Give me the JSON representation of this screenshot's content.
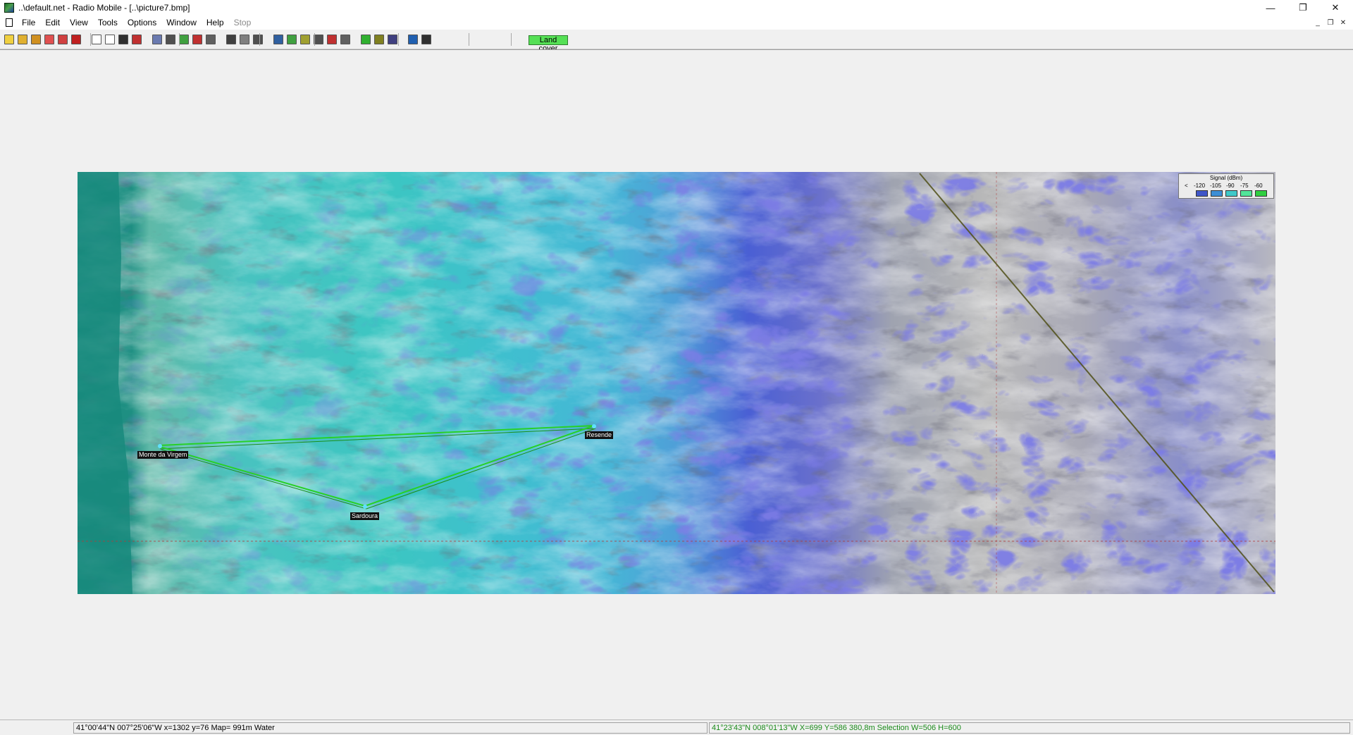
{
  "window": {
    "title": "..\\default.net - Radio Mobile - [..\\picture7.bmp]",
    "controls": {
      "minimize": "—",
      "restore": "❐",
      "close": "✕"
    },
    "mdi_controls": {
      "minimize": "_",
      "restore": "❐",
      "close": "✕"
    }
  },
  "menu": {
    "items": [
      "File",
      "Edit",
      "View",
      "Tools",
      "Options",
      "Window",
      "Help",
      "Stop"
    ]
  },
  "toolbar": {
    "land_cover_label": "Land cover",
    "buttons": [
      {
        "name": "new-icon",
        "color": "#f0d040"
      },
      {
        "name": "open-icon",
        "color": "#e0b030"
      },
      {
        "name": "open-networks-icon",
        "color": "#d09020"
      },
      {
        "name": "network-properties-icon",
        "color": "#e05050"
      },
      {
        "name": "unit-properties-icon",
        "color": "#d04040"
      },
      {
        "name": "radio-link-icon",
        "color": "#c02020"
      },
      {
        "name": "picture-new-icon",
        "color": "#ffffff"
      },
      {
        "name": "picture-open-icon",
        "color": "#ffffff"
      },
      {
        "name": "picture-save-icon",
        "color": "#303030"
      },
      {
        "name": "picture-close-icon",
        "color": "#c03030"
      },
      {
        "name": "copy-icon",
        "color": "#6a7ab0"
      },
      {
        "name": "merge-icon",
        "color": "#505050"
      },
      {
        "name": "terrain-icon",
        "color": "#40a040"
      },
      {
        "name": "rings-icon",
        "color": "#c03030"
      },
      {
        "name": "grayscale-icon",
        "color": "#606060"
      },
      {
        "name": "scale-icon",
        "color": "#404040"
      },
      {
        "name": "center-icon",
        "color": "#808080"
      },
      {
        "name": "map-properties-icon",
        "color": "#505050"
      },
      {
        "name": "map-window-icon",
        "color": "#3060a0"
      },
      {
        "name": "elevation-grid-icon",
        "color": "#40a040"
      },
      {
        "name": "polar-icon",
        "color": "#a0a030"
      },
      {
        "name": "cartesian-icon",
        "color": "#505050"
      },
      {
        "name": "find-best-site-icon",
        "color": "#c03030"
      },
      {
        "name": "coverage-icon",
        "color": "#606060"
      },
      {
        "name": "route-icon",
        "color": "#30b030"
      },
      {
        "name": "link-budget-icon",
        "color": "#808020"
      },
      {
        "name": "hop-icon",
        "color": "#404080"
      },
      {
        "name": "world-icon",
        "color": "#2060b0"
      },
      {
        "name": "globe-icon",
        "color": "#303030"
      }
    ]
  },
  "map": {
    "units": [
      "Monte da Virgem",
      "Resende",
      "Sardoura"
    ],
    "legend": {
      "title": "Signal (dBm)",
      "ticks": [
        "<",
        "-120",
        "-105",
        "-90",
        "-75",
        "-60"
      ],
      "colors": [
        "#2a2ab8",
        "#3f56c8",
        "#3d8fd6",
        "#3fc9c9",
        "#52e59a",
        "#2fcf40"
      ]
    },
    "link_color": "#28d028"
  },
  "status": {
    "left": "41°00'44\"N  007°25'06\"W   x=1302 y=76 Map= 991m Water",
    "right": "41°23'43\"N 008°01'13\"W  X=699 Y=586 380,8m Selection W=506 H=600",
    "right_color": "#1a8a1a"
  }
}
